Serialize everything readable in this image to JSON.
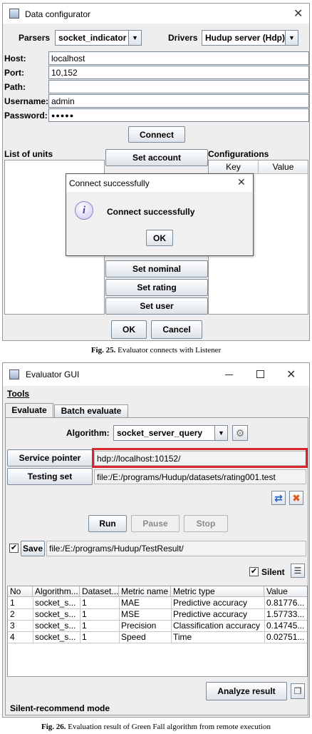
{
  "fig25": {
    "title": "Data configurator",
    "parsers_label": "Parsers",
    "parser_value": "socket_indicator",
    "drivers_label": "Drivers",
    "driver_value": "Hudup server (Hdp)",
    "host_label": "Host:",
    "host_value": "localhost",
    "port_label": "Port:",
    "port_value": "10,152",
    "path_label": "Path:",
    "path_value": "",
    "username_label": "Username:",
    "username_value": "admin",
    "password_label": "Password:",
    "password_value": "●●●●●",
    "connect_label": "Connect",
    "units_label": "List of units",
    "configs_label": "Configurations",
    "key_header": "Key",
    "value_header": "Value",
    "buttons": [
      "Set account",
      "Set nominal",
      "Set rating",
      "Set user"
    ],
    "ok_label": "OK",
    "cancel_label": "Cancel",
    "dialog": {
      "title": "Connect successfully",
      "message": "Connect successfully",
      "ok_label": "OK",
      "info_glyph": "i"
    },
    "caption_label": "Fig. 25.",
    "caption_text": "Evaluator connects with Listener"
  },
  "fig26": {
    "title": "Evaluator GUI",
    "menu_tools": "Tools",
    "tab_evaluate": "Evaluate",
    "tab_batch": "Batch evaluate",
    "algorithm_label": "Algorithm:",
    "algorithm_value": "socket_server_query",
    "service_pointer_label": "Service pointer",
    "service_pointer_value": "hdp://localhost:10152/",
    "testing_set_label": "Testing set",
    "testing_set_value": "file:/E:/programs/Hudup/datasets/rating001.test",
    "run_label": "Run",
    "pause_label": "Pause",
    "stop_label": "Stop",
    "save_label": "Save",
    "save_path": "file:/E:/programs/Hudup/TestResult/",
    "silent_label": "Silent",
    "highlight_color": "#d9262c",
    "table": {
      "headers": [
        "No",
        "Algorithm...",
        "Dataset...",
        "Metric name",
        "Metric type",
        "Value"
      ],
      "rows": [
        [
          "1",
          "socket_s...",
          "1",
          "MAE",
          "Predictive accuracy",
          "0.81776..."
        ],
        [
          "2",
          "socket_s...",
          "1",
          "MSE",
          "Predictive accuracy",
          "1.57733..."
        ],
        [
          "3",
          "socket_s...",
          "1",
          "Precision",
          "Classification accuracy",
          "0.14745..."
        ],
        [
          "4",
          "socket_s...",
          "1",
          "Speed",
          "Time",
          "0.02751..."
        ]
      ]
    },
    "analyze_label": "Analyze result",
    "status": "Silent-recommend mode",
    "caption_label": "Fig. 26.",
    "caption_text": "Evaluation result of Green Fall algorithm from remote execution"
  }
}
